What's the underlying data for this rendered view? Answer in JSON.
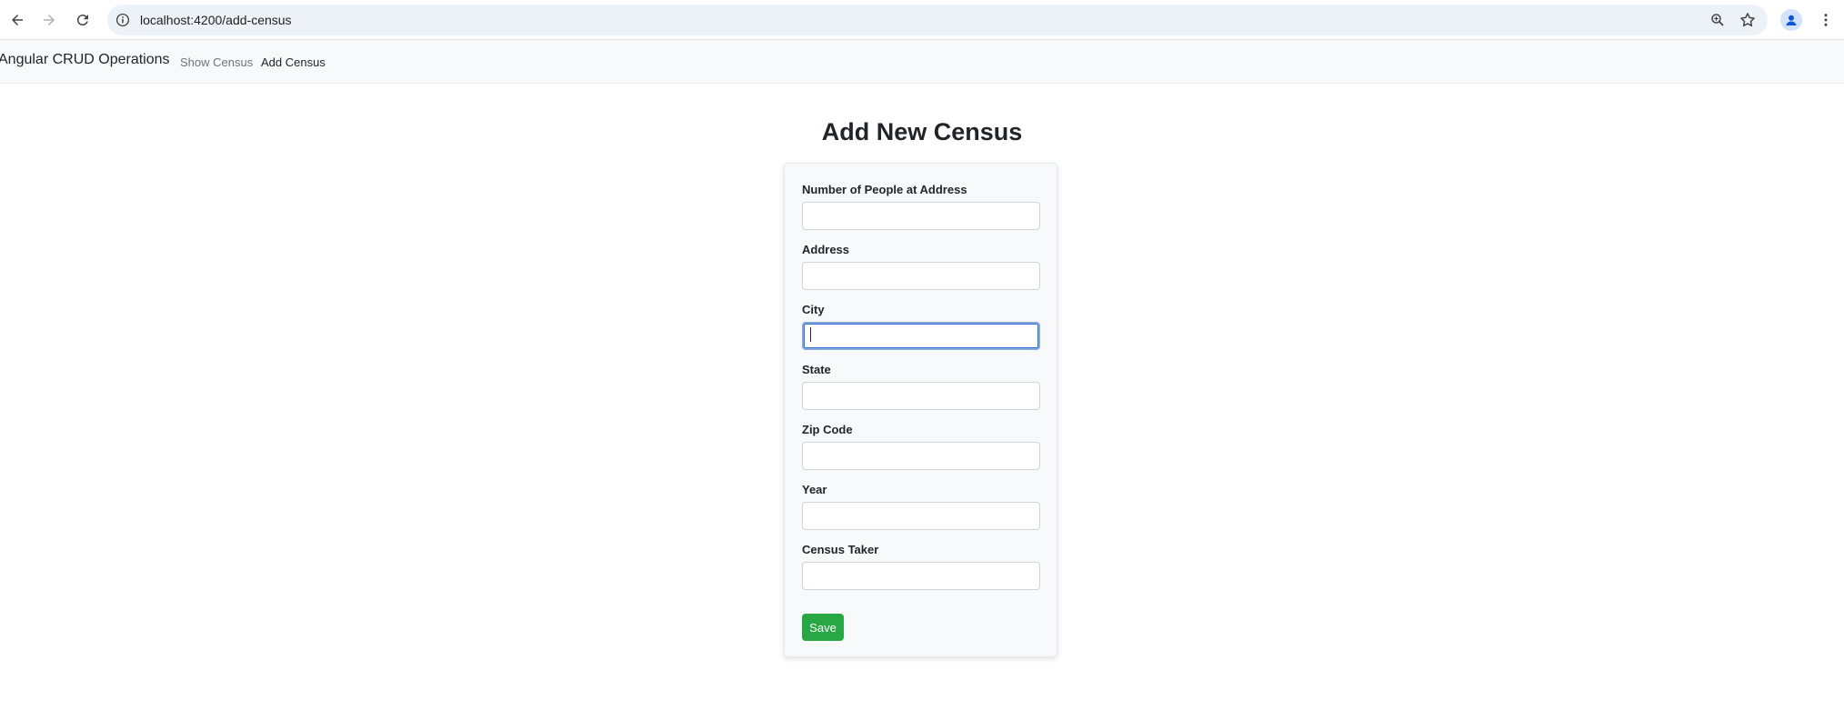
{
  "browser": {
    "url": "localhost:4200/add-census",
    "icons": [
      "back-arrow-icon",
      "forward-arrow-icon",
      "reload-icon",
      "info-icon",
      "zoom-icon",
      "star-icon",
      "profile-icon",
      "kebab-menu-icon"
    ]
  },
  "navbar": {
    "brand": "Angular CRUD Operations",
    "links": [
      {
        "label": "Show Census",
        "active": false
      },
      {
        "label": "Add Census",
        "active": true
      }
    ]
  },
  "page": {
    "title": "Add New Census"
  },
  "form": {
    "fields": [
      {
        "label": "Number of People at Address",
        "value": ""
      },
      {
        "label": "Address",
        "value": ""
      },
      {
        "label": "City",
        "value": "",
        "focused": true
      },
      {
        "label": "State",
        "value": ""
      },
      {
        "label": "Zip Code",
        "value": ""
      },
      {
        "label": "Year",
        "value": ""
      },
      {
        "label": "Census Taker",
        "value": ""
      }
    ],
    "save_label": "Save"
  },
  "colors": {
    "save_button": "#28a745",
    "navbar_bg": "#f8f9fa",
    "focus_border": "#86a8dd"
  }
}
